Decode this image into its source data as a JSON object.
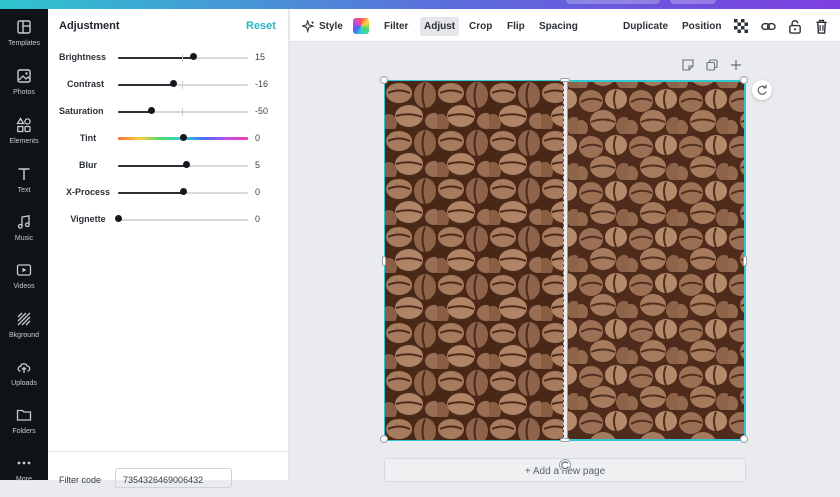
{
  "nav": {
    "items": [
      {
        "label": "Templates",
        "icon": "templates-icon"
      },
      {
        "label": "Photos",
        "icon": "photos-icon"
      },
      {
        "label": "Elements",
        "icon": "elements-icon"
      },
      {
        "label": "Text",
        "icon": "text-icon"
      },
      {
        "label": "Music",
        "icon": "music-icon"
      },
      {
        "label": "Videos",
        "icon": "videos-icon"
      },
      {
        "label": "Bkground",
        "icon": "background-icon"
      },
      {
        "label": "Uploads",
        "icon": "uploads-icon"
      },
      {
        "label": "Folders",
        "icon": "folders-icon"
      },
      {
        "label": "More",
        "icon": "more-icon"
      }
    ]
  },
  "panel": {
    "title": "Adjustment",
    "reset_label": "Reset",
    "sliders": [
      {
        "label": "Brightness",
        "value": "15",
        "level": 0.575
      },
      {
        "label": "Contrast",
        "value": "-16",
        "level": 0.42
      },
      {
        "label": "Saturation",
        "value": "-50",
        "level": 0.25
      },
      {
        "label": "Tint",
        "value": "0",
        "level": 0.5
      },
      {
        "label": "Blur",
        "value": "5",
        "level": 0.52
      },
      {
        "label": "X-Process",
        "value": "0",
        "level": 0.5
      },
      {
        "label": "Vignette",
        "value": "0",
        "level": 0.0
      }
    ],
    "filter_code_label": "Filter code",
    "filter_code_value": "7354326469006432"
  },
  "toolbar": {
    "style_label": "Style",
    "filter_label": "Filter",
    "adjust_label": "Adjust",
    "crop_label": "Crop",
    "flip_label": "Flip",
    "spacing_label": "Spacing",
    "duplicate_label": "Duplicate",
    "position_label": "Position"
  },
  "canvas": {
    "add_page_label": "+ Add a new page"
  },
  "colors": {
    "accent": "#29b6c7",
    "nav_bg": "#0e1318",
    "selection": "#30c6d4"
  }
}
